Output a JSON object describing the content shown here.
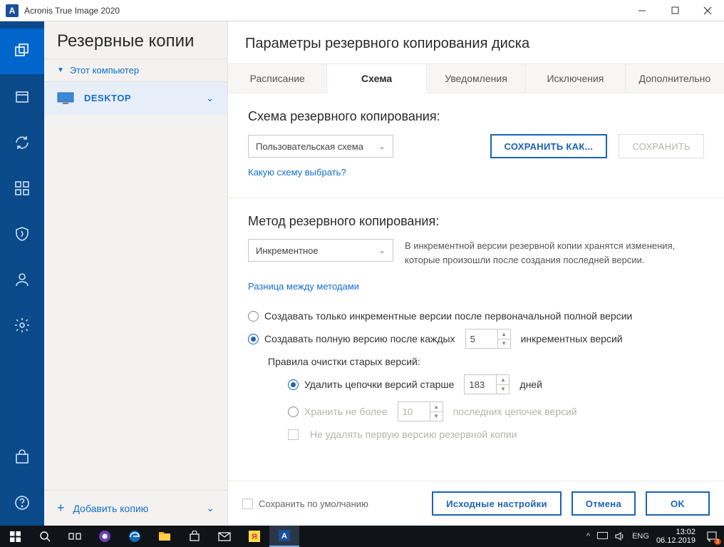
{
  "titlebar": {
    "app_icon_letter": "A",
    "title": "Acronis True Image 2020"
  },
  "sidebar": {
    "heading": "Резервные копии",
    "device_label": "Этот компьютер",
    "backup_item": "DESKTOP",
    "add_label": "Добавить копию"
  },
  "main": {
    "title": "Параметры резервного копирования диска",
    "tabs": [
      "Расписание",
      "Схема",
      "Уведомления",
      "Исключения",
      "Дополнительно"
    ],
    "scheme": {
      "heading": "Схема резервного копирования:",
      "select_value": "Пользовательская схема",
      "save_as": "СОХРАНИТЬ КАК...",
      "save": "СОХРАНИТЬ",
      "help_link": "Какую схему выбрать?"
    },
    "method": {
      "heading": "Метод резервного копирования:",
      "select_value": "Инкрементное",
      "description": "В инкрементной версии резервной копии хранятся изменения, которые произошли после создания последней версии.",
      "diff_link": "Разница между методами",
      "opt_only_incremental": "Создавать только инкрементные версии после первоначальной полной версии",
      "opt_full_after_prefix": "Создавать полную версию после каждых",
      "opt_full_after_value": "5",
      "opt_full_after_suffix": "инкрементных версий",
      "cleanup_title": "Правила очистки старых версий:",
      "cleanup_delete_prefix": "Удалить цепочки версий старше",
      "cleanup_delete_value": "183",
      "cleanup_delete_suffix": "дней",
      "cleanup_keep_prefix": "Хранить не более",
      "cleanup_keep_value": "10",
      "cleanup_keep_suffix": "последних цепочек версий",
      "cleanup_no_delete_first": "Не удалять первую версию резервной копии"
    },
    "footer": {
      "save_default": "Сохранить по умолчанию",
      "defaults": "Исходные настройки",
      "cancel": "Отмена",
      "ok": "OK"
    }
  },
  "taskbar": {
    "lang": "ENG",
    "time": "13:02",
    "date": "06.12.2019",
    "notif_count": "3"
  }
}
